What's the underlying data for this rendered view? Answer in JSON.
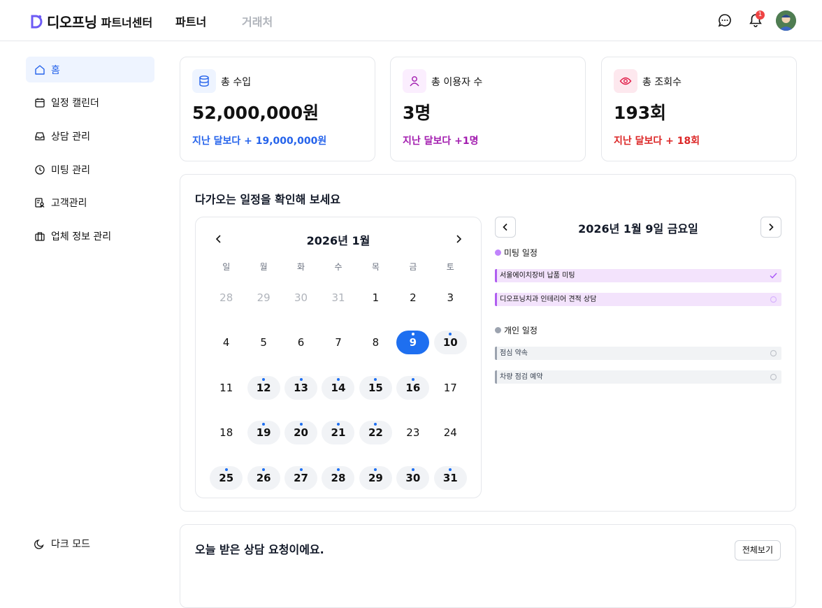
{
  "header": {
    "logo_text": "디오프닝",
    "logo_sub": "파트너센터",
    "tabs": [
      {
        "label": "파트너",
        "active": true
      },
      {
        "label": "거래처",
        "active": false
      }
    ],
    "notification_count": "1",
    "icons": [
      "chat-icon",
      "bell-icon",
      "avatar"
    ]
  },
  "sidebar": {
    "items": [
      {
        "label": "홈",
        "icon": "home-icon",
        "active": true
      },
      {
        "label": "일정 캘린더",
        "icon": "calendar-icon"
      },
      {
        "label": "상담 관리",
        "icon": "inbox-icon"
      },
      {
        "label": "미팅 관리",
        "icon": "clock-icon"
      },
      {
        "label": "고객관리",
        "icon": "customer-icon"
      },
      {
        "label": "업체 정보 관리",
        "icon": "briefcase-icon"
      }
    ],
    "dark_mode_label": "다크 모드"
  },
  "stats": [
    {
      "label": "총 수입",
      "value": "52,000,000원",
      "diff": "지난 달보다 + 19,000,000원",
      "color": "#2563eb",
      "icon": "database-icon"
    },
    {
      "label": "총 이용자 수",
      "value": "3명",
      "diff": "지난 달보다 +1명",
      "color": "#a21caf",
      "icon": "user-icon"
    },
    {
      "label": "총 조회수",
      "value": "193회",
      "diff": "지난 달보다 + 18회",
      "color": "#dc2626",
      "icon": "eye-icon"
    }
  ],
  "schedule": {
    "title": "다가오는 일정을 확인해 보세요",
    "calendar": {
      "month_label": "2026년 1월",
      "weekdays": [
        "일",
        "월",
        "화",
        "수",
        "목",
        "금",
        "토"
      ],
      "days": [
        {
          "d": "28",
          "muted": true
        },
        {
          "d": "29",
          "muted": true
        },
        {
          "d": "30",
          "muted": true
        },
        {
          "d": "31",
          "muted": true
        },
        {
          "d": "1"
        },
        {
          "d": "2"
        },
        {
          "d": "3"
        },
        {
          "d": "4"
        },
        {
          "d": "5"
        },
        {
          "d": "6"
        },
        {
          "d": "7"
        },
        {
          "d": "8"
        },
        {
          "d": "9",
          "selected": true,
          "event": true
        },
        {
          "d": "10",
          "event": true
        },
        {
          "d": "11"
        },
        {
          "d": "12",
          "event": true
        },
        {
          "d": "13",
          "event": true
        },
        {
          "d": "14",
          "event": true
        },
        {
          "d": "15",
          "event": true
        },
        {
          "d": "16",
          "event": true
        },
        {
          "d": "17"
        },
        {
          "d": "18"
        },
        {
          "d": "19",
          "event": true
        },
        {
          "d": "20",
          "event": true
        },
        {
          "d": "21",
          "event": true
        },
        {
          "d": "22",
          "event": true
        },
        {
          "d": "23"
        },
        {
          "d": "24"
        },
        {
          "d": "25",
          "event": true
        },
        {
          "d": "26",
          "event": true
        },
        {
          "d": "27",
          "event": true
        },
        {
          "d": "28",
          "event": true
        },
        {
          "d": "29",
          "event": true
        },
        {
          "d": "30",
          "event": true
        },
        {
          "d": "31",
          "event": true
        }
      ]
    },
    "detail": {
      "date_label": "2026년 1월 9일 금요일",
      "meeting_group": "미팅 일정",
      "meeting_color": "#c084fc",
      "meetings": [
        {
          "title": "서울에이치장비 납품 미팅",
          "done": true
        },
        {
          "title": "디오프닝치과 인테리어 견적 상담",
          "done": false
        }
      ],
      "personal_group": "개인 일정",
      "personal_color": "#9ca3af",
      "personal": [
        {
          "title": "점심 약속",
          "done": false
        },
        {
          "title": "차량 점검 예약",
          "done": false
        }
      ]
    }
  },
  "requests": {
    "title": "오늘 받은 상담 요청이에요.",
    "view_all_label": "전체보기"
  }
}
